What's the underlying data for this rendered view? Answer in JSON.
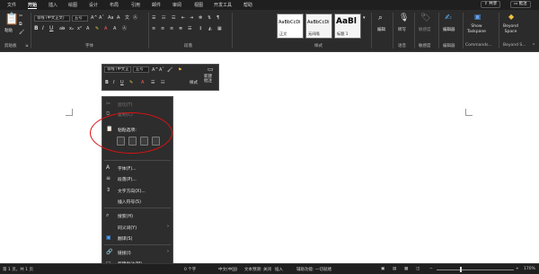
{
  "ribbon": {
    "tabs": [
      "文件",
      "开始",
      "插入",
      "绘图",
      "设计",
      "布局",
      "引用",
      "邮件",
      "审阅",
      "视图",
      "开发工具",
      "帮助"
    ],
    "active_tab": "开始",
    "share_label": "共享",
    "comments_label": "批注",
    "paste_label": "粘贴",
    "font_name": "等线 (中文正文)",
    "font_size": "五号",
    "styles": [
      {
        "preview": "AaBbCcDi",
        "name": "正文"
      },
      {
        "preview": "AaBbCcDi",
        "name": "无间隔"
      },
      {
        "preview": "AaBl",
        "name": "标题 1"
      }
    ],
    "edit_label": "编辑",
    "dictate_label": "听写",
    "sensitivity_label": "敏感度",
    "editor_label": "编辑器",
    "show_taskpane_label": "Show\nTaskpane",
    "beyond_space_label": "Beyond\nSpace",
    "groups": [
      "剪贴板",
      "字体",
      "段落",
      "样式",
      "语音",
      "敏感度",
      "编辑器",
      "Commands...",
      "Beyond S..."
    ]
  },
  "mini_toolbar": {
    "font_name": "等线 (中文正",
    "font_size": "五号",
    "styles_label": "样式",
    "new_comment_label": "新建\n批注"
  },
  "context_menu": {
    "items_top": [
      {
        "label": "剪切(T)",
        "icon": "scissors-icon",
        "disabled": true
      },
      {
        "label": "复制(C)",
        "icon": "copy-icon",
        "disabled": true
      }
    ],
    "paste_options_label": "粘贴选项:",
    "items_bottom": [
      {
        "label": "字体(F)...",
        "icon": "font-icon"
      },
      {
        "label": "段落(P)...",
        "icon": "paragraph-icon"
      },
      {
        "label": "文字方向(X)...",
        "icon": "text-direction-icon"
      },
      {
        "label": "插入符号(S)",
        "icon": ""
      },
      {
        "label": "搜索(H)",
        "icon": "search-icon"
      },
      {
        "label": "同义词(Y)",
        "icon": "",
        "submenu": true
      },
      {
        "label": "翻译(S)",
        "icon": "translate-icon"
      },
      {
        "label": "链接(I)",
        "icon": "link-icon",
        "submenu": true
      },
      {
        "label": "新建批注(M)",
        "icon": "comment-icon"
      }
    ]
  },
  "status_bar": {
    "page": "第 1 页，共 1 页",
    "words": "0 个字",
    "language": "中文(中国)",
    "text_predictions": "文本预测: 关闭",
    "insert_mode": "插入",
    "accessibility": "辅助功能: 一切就绪",
    "zoom": "170%"
  },
  "colors": {
    "ribbon_bg": "#2b2b2b",
    "tab_bg": "#1f1f1f",
    "menu_bg": "#2d2d2d",
    "annotation": "#dd1111"
  }
}
